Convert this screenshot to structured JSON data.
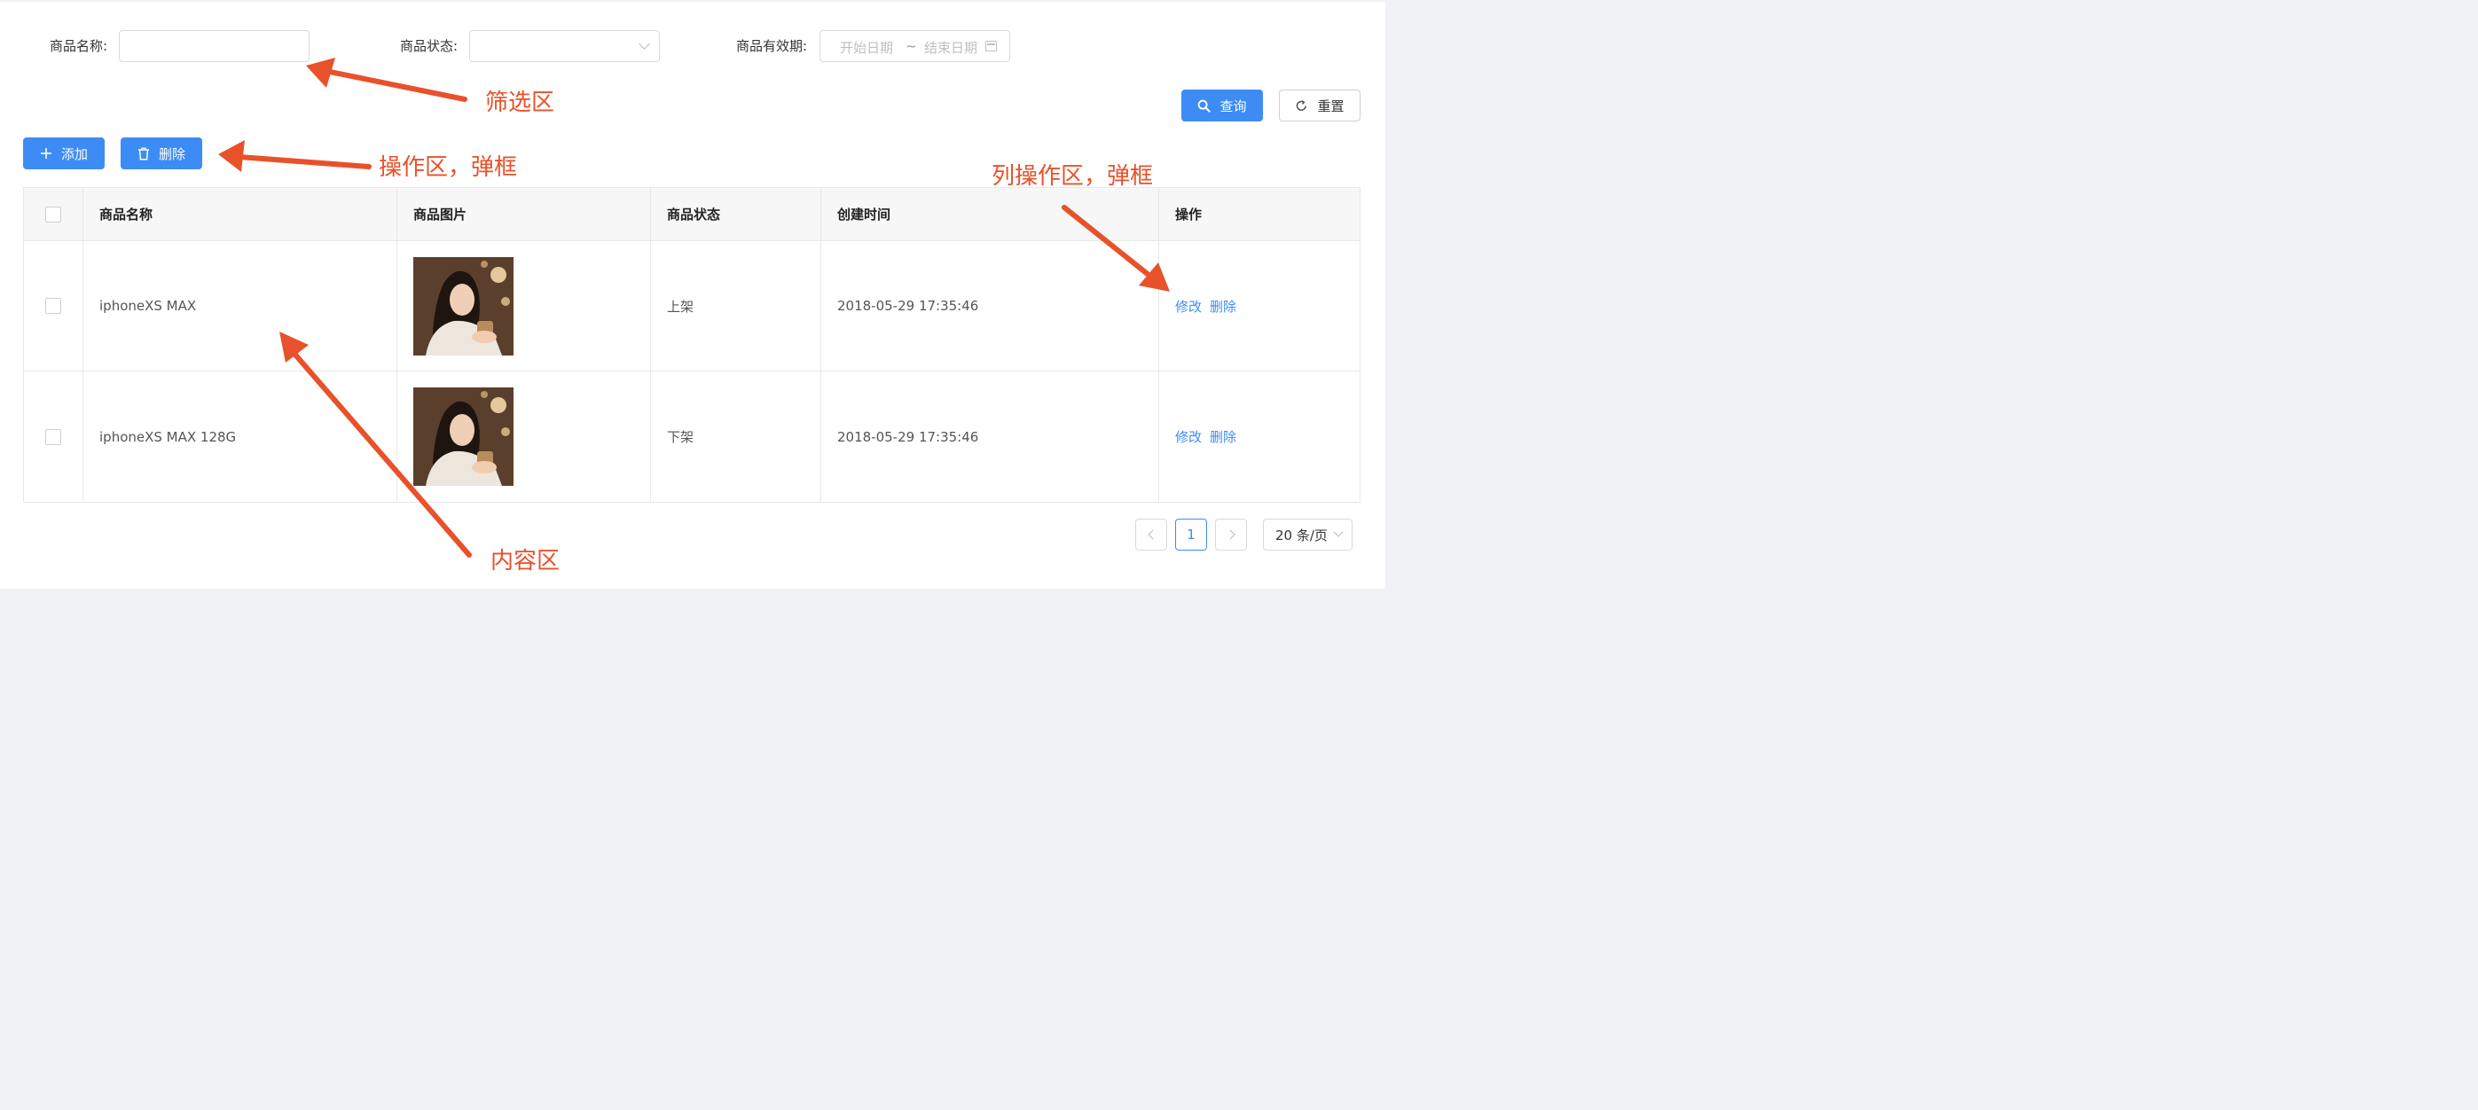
{
  "filters": {
    "name_label": "商品名称:",
    "name_value": "",
    "status_label": "商品状态:",
    "status_value": "",
    "validity_label": "商品有效期:",
    "start_placeholder": "开始日期",
    "range_sep": "~",
    "end_placeholder": "结束日期"
  },
  "search": {
    "query_label": "查询",
    "reset_label": "重置"
  },
  "toolbar": {
    "add_label": "添加",
    "delete_label": "删除"
  },
  "table": {
    "columns": [
      "商品名称",
      "商品图片",
      "商品状态",
      "创建时间",
      "操作"
    ],
    "rows": [
      {
        "name": "iphoneXS MAX",
        "status": "上架",
        "created": "2018-05-29 17:35:46",
        "edit": "修改",
        "delete": "删除"
      },
      {
        "name": "iphoneXS MAX 128G",
        "status": "下架",
        "created": "2018-05-29 17:35:46",
        "edit": "修改",
        "delete": "删除"
      }
    ]
  },
  "pagination": {
    "current_page": "1",
    "page_size": "20 条/页"
  },
  "annotations": {
    "filter_area": "筛选区",
    "action_area": "操作区，弹框",
    "column_action_area": "列操作区，弹框",
    "content_area": "内容区"
  },
  "colors": {
    "primary": "#3d8cf5",
    "annotation": "#e8512a",
    "background": "#f0f2f5"
  }
}
